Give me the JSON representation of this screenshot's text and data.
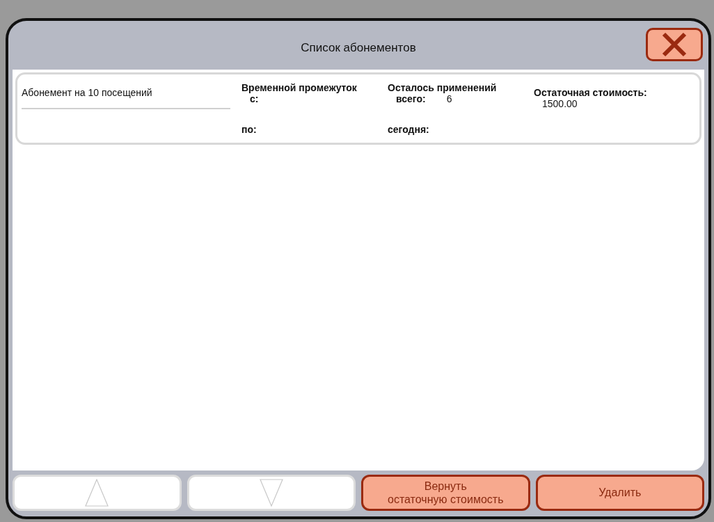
{
  "window": {
    "title": "Список абонементов"
  },
  "subscriptions": [
    {
      "name": "Абонемент на 10 посещений",
      "period_label": "Временной промежуток",
      "from_label": "с:",
      "to_label": "по:",
      "uses_label": "Осталось применений",
      "total_label": "всего:",
      "total_value": "6",
      "today_label": "сегодня:",
      "residual_label": "Остаточная стоимость:",
      "residual_value": "1500.00"
    }
  ],
  "buttons": [
    {
      "kind": "up",
      "disabled": true
    },
    {
      "kind": "down",
      "disabled": true
    },
    {
      "kind": "text",
      "label": "Вернуть\nостаточную стоимость",
      "disabled": false
    },
    {
      "kind": "text",
      "label": "Удалить",
      "disabled": false
    }
  ]
}
